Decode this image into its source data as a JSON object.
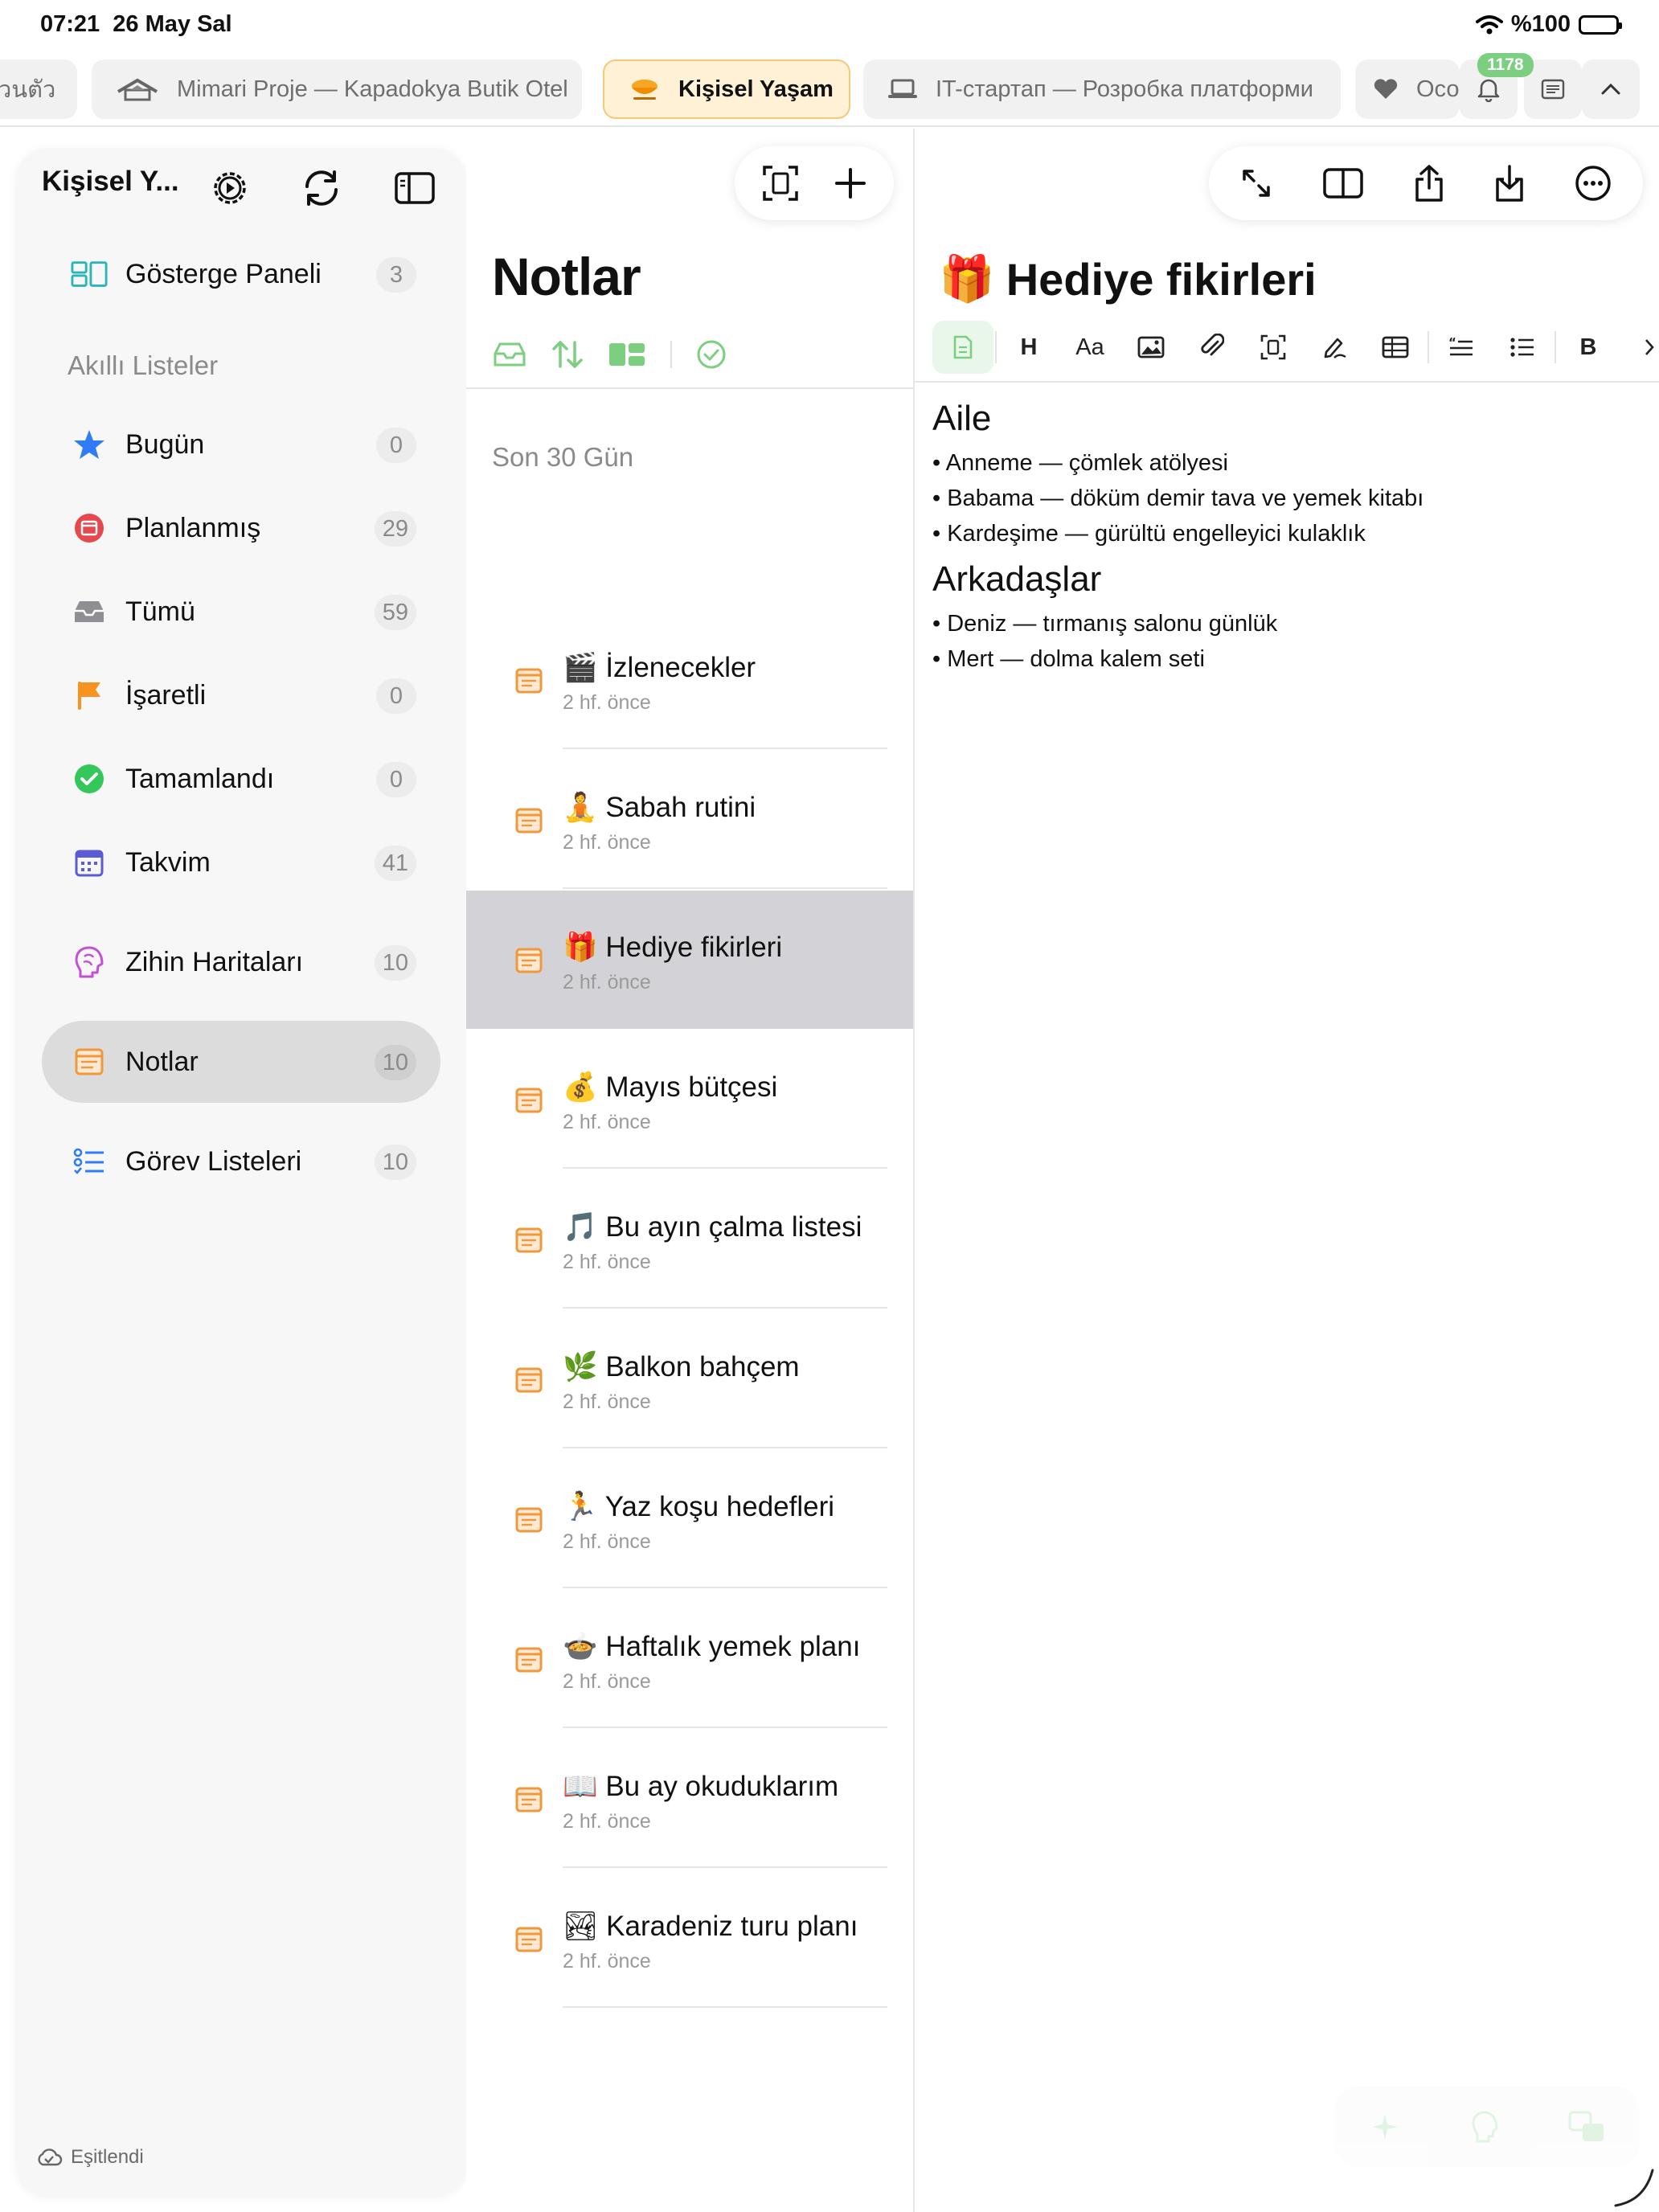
{
  "status": {
    "time": "07:21",
    "date": "26 May Sal",
    "battery": "%100"
  },
  "tabs": [
    {
      "label": "วนตัว",
      "icon": "",
      "active": false
    },
    {
      "label": "Mimari Proje — Kapadokya Butik Otel",
      "icon": "house-icon",
      "active": false
    },
    {
      "label": "Kişisel Yaşam",
      "icon": "coffee-icon",
      "active": true
    },
    {
      "label": "IT-стартап — Розробка платформи",
      "icon": "laptop-icon",
      "active": false
    },
    {
      "label": "Осо",
      "icon": "heart-icon",
      "active": false
    }
  ],
  "notifications": {
    "count": "1178"
  },
  "sidebar": {
    "title": "Kişisel Y...",
    "dashboard": {
      "label": "Gösterge Paneli",
      "count": "3"
    },
    "smart_lists_label": "Akıllı Listeler",
    "smart_lists": [
      {
        "label": "Bugün",
        "count": "0",
        "icon": "star-icon",
        "color": "#2f7cf6"
      },
      {
        "label": "Planlanmış",
        "count": "29",
        "icon": "calendar-clock-icon",
        "color": "#e5484d"
      },
      {
        "label": "Tümü",
        "count": "59",
        "icon": "tray-icon",
        "color": "#8e8e93"
      },
      {
        "label": "İşaretli",
        "count": "0",
        "icon": "flag-icon",
        "color": "#f7931e"
      },
      {
        "label": "Tamamlandı",
        "count": "0",
        "icon": "checkmark-circle-icon",
        "color": "#34c759"
      },
      {
        "label": "Takvim",
        "count": "41",
        "icon": "calendar-icon",
        "color": "#5b5bd6"
      }
    ],
    "mind_maps": {
      "label": "Zihin Haritaları",
      "count": "10"
    },
    "notes": {
      "label": "Notlar",
      "count": "10"
    },
    "task_lists": {
      "label": "Görev Listeleri",
      "count": "10"
    },
    "sync_status": "Eşitlendi"
  },
  "notes_list": {
    "title": "Notlar",
    "section": "Son 30 Gün",
    "items": [
      {
        "emoji": "🎬",
        "title": "İzlenecekler",
        "time": "2 hf. önce"
      },
      {
        "emoji": "🧘",
        "title": "Sabah rutini",
        "time": "2 hf. önce"
      },
      {
        "emoji": "🎁",
        "title": "Hediye fikirleri",
        "time": "2 hf. önce"
      },
      {
        "emoji": "💰",
        "title": "Mayıs bütçesi",
        "time": "2 hf. önce"
      },
      {
        "emoji": "🎵",
        "title": "Bu ayın çalma listesi",
        "time": "2 hf. önce"
      },
      {
        "emoji": "🌿",
        "title": "Balkon bahçem",
        "time": "2 hf. önce"
      },
      {
        "emoji": "🏃",
        "title": "Yaz koşu hedefleri",
        "time": "2 hf. önce"
      },
      {
        "emoji": "🍲",
        "title": "Haftalık yemek planı",
        "time": "2 hf. önce"
      },
      {
        "emoji": "📖",
        "title": "Bu ay okuduklarım",
        "time": "2 hf. önce"
      },
      {
        "emoji": "🏞",
        "title": "Karadeniz turu planı",
        "time": "2 hf. önce"
      }
    ],
    "selected_index": 2
  },
  "editor": {
    "title_emoji": "🎁",
    "title": "Hediye fikirleri",
    "format_bar": {
      "heading": "H",
      "font_size": "Aa",
      "bold": "B"
    },
    "sections": [
      {
        "heading": "Aile",
        "items": [
          "Anneme — çömlek atölyesi",
          "Babama — döküm demir tava ve yemek kitabı",
          "Kardeşime — gürültü engelleyici kulaklık"
        ]
      },
      {
        "heading": "Arkadaşlar",
        "items": [
          "Deniz — tırmanış salonu günlük",
          "Mert — dolma kalem seti"
        ]
      }
    ]
  },
  "colors": {
    "accent_green": "#34c759",
    "note_icon": "#f0983a",
    "tab_active_bg": "#fff1d6"
  }
}
